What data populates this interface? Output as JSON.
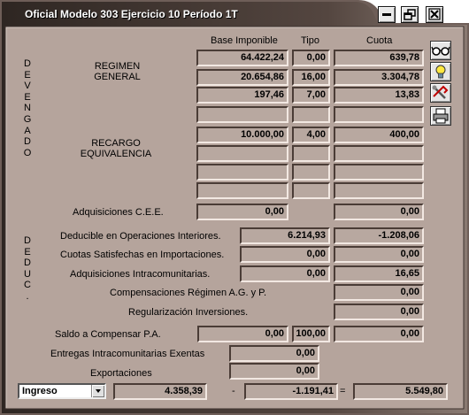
{
  "window": {
    "title": "Oficial Modelo 303 Ejercicio 10 Período 1T"
  },
  "headers": {
    "base": "Base Imponible",
    "tipo": "Tipo",
    "cuota": "Cuota"
  },
  "sections": {
    "devengado": "DEVENGADO",
    "deduc": "DEDUC."
  },
  "regimen_general": {
    "label_line1": "REGIMEN",
    "label_line2": "GENERAL",
    "rows": [
      {
        "base": "64.422,24",
        "tipo": "0,00",
        "cuota": "639,78"
      },
      {
        "base": "20.654,86",
        "tipo": "16,00",
        "cuota": "3.304,78"
      },
      {
        "base": "197,46",
        "tipo": "7,00",
        "cuota": "13,83"
      },
      {
        "base": "",
        "tipo": "",
        "cuota": ""
      }
    ]
  },
  "recargo": {
    "label_line1": "RECARGO",
    "label_line2": "EQUIVALENCIA",
    "rows": [
      {
        "base": "10.000,00",
        "tipo": "4,00",
        "cuota": "400,00"
      },
      {
        "base": "",
        "tipo": "",
        "cuota": ""
      },
      {
        "base": "",
        "tipo": "",
        "cuota": ""
      },
      {
        "base": "",
        "tipo": "",
        "cuota": ""
      }
    ]
  },
  "adquisiciones_cee": {
    "label": "Adquisiciones C.E.E.",
    "base": "0,00",
    "cuota": "0,00"
  },
  "deducciones": {
    "operaciones_interiores": {
      "label": "Deducible en Operaciones Interiores.",
      "base": "6.214,93",
      "cuota": "-1.208,06"
    },
    "importaciones": {
      "label": "Cuotas Satisfechas en Importaciones.",
      "base": "0,00",
      "cuota": "0,00"
    },
    "intracomunitarias": {
      "label": "Adquisiciones Intracomunitarias.",
      "base": "0,00",
      "cuota": "16,65"
    },
    "compensaciones": {
      "label": "Compensaciones Régimen A.G. y P.",
      "cuota": "0,00"
    },
    "regularizacion": {
      "label": "Regularización Inversiones.",
      "cuota": "0,00"
    }
  },
  "saldo": {
    "label": "Saldo a Compensar P.A.",
    "base": "0,00",
    "tipo": "100,00",
    "cuota": "0,00"
  },
  "entregas": {
    "label": "Entregas Intracomunitarias Exentas",
    "value": "0,00"
  },
  "exportaciones": {
    "label": "Exportaciones",
    "value": "0,00"
  },
  "footer": {
    "select_value": "Ingreso",
    "total1": "4.358,39",
    "minus": "-",
    "total2": "-1.191,41",
    "equals": "=",
    "result": "5.549,80"
  },
  "icons": {
    "minimize": "minimize-icon",
    "restore": "restore-icon",
    "close": "close-icon",
    "glasses": "glasses-icon",
    "bulb": "lightbulb-icon",
    "tools": "tools-icon",
    "print": "printer-icon"
  },
  "colors": {
    "panel": "#b5a49c",
    "field": "#b8a8a0",
    "frame": "#6e5e58"
  }
}
